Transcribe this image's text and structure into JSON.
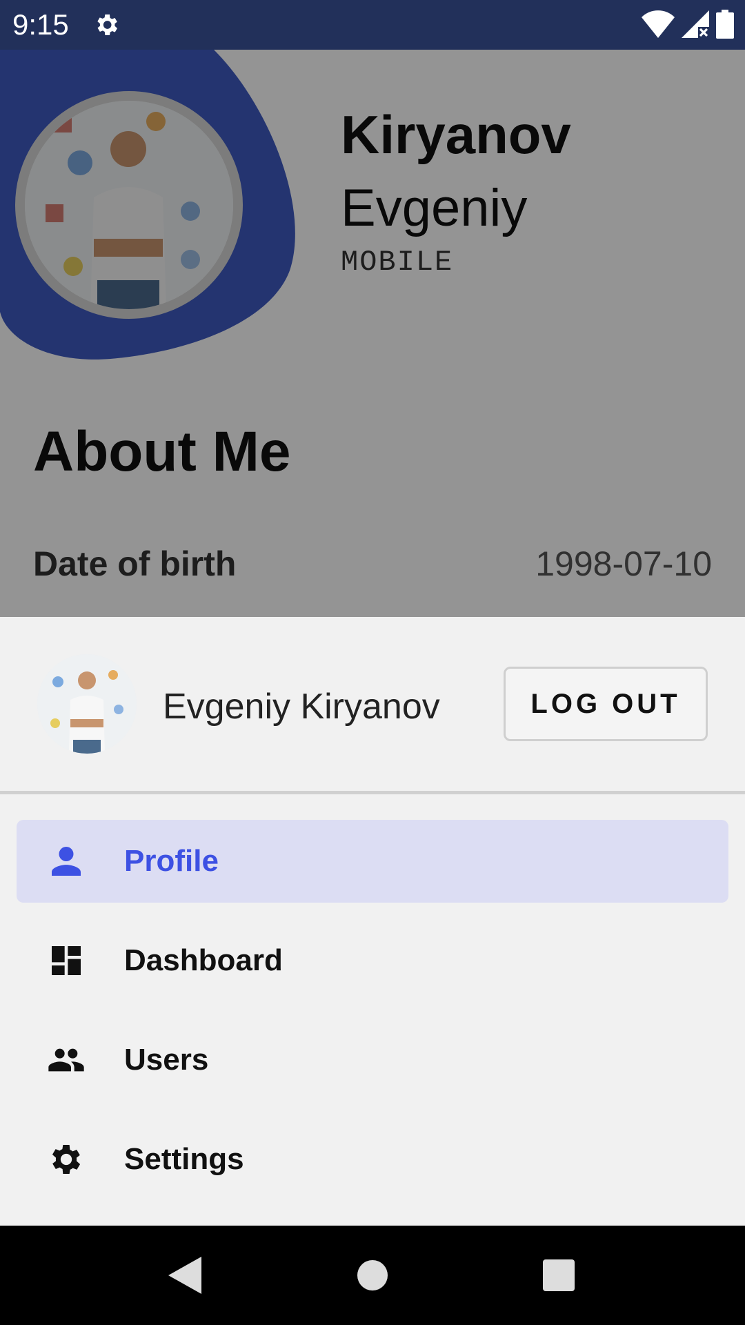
{
  "status_bar": {
    "time": "9:15",
    "background": "#22305a"
  },
  "profile": {
    "last_name": "Kiryanov",
    "first_name": "Evgeniy",
    "role": "MOBILE",
    "blob_color": "#3f5bc2"
  },
  "about": {
    "title": "About Me",
    "fields": [
      {
        "label": "Date of birth",
        "value": "1998-07-10"
      }
    ]
  },
  "drawer": {
    "user_name": "Evgeniy Kiryanov",
    "logout_label": "LOG OUT",
    "accent": "#3d51e3",
    "active_bg": "#dcddf3",
    "menu": [
      {
        "label": "Profile",
        "icon": "person-icon",
        "active": true
      },
      {
        "label": "Dashboard",
        "icon": "dashboard-icon",
        "active": false
      },
      {
        "label": "Users",
        "icon": "group-icon",
        "active": false
      },
      {
        "label": "Settings",
        "icon": "gear-icon",
        "active": false
      }
    ]
  },
  "nav_bar": {
    "buttons": [
      "back-icon",
      "home-icon",
      "recents-icon"
    ]
  }
}
